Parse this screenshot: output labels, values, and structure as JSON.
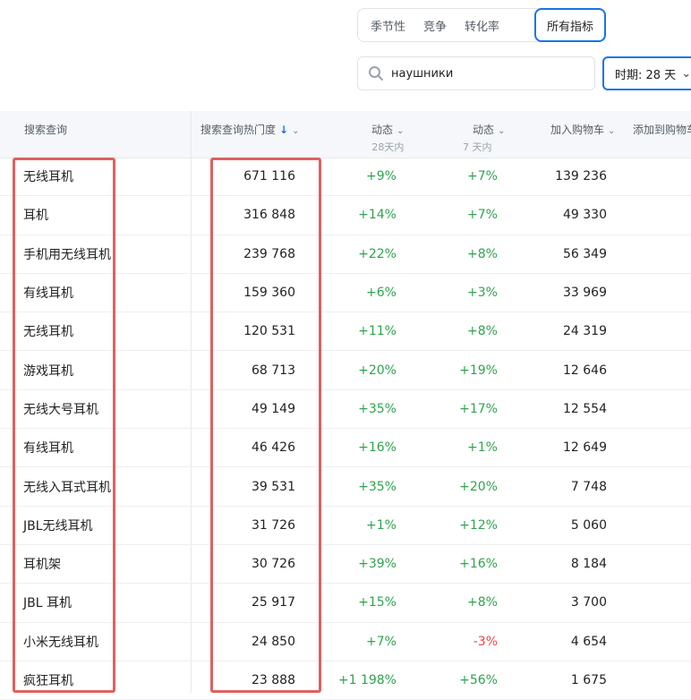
{
  "tabs": [
    {
      "label": "季节性",
      "active": false
    },
    {
      "label": "竞争",
      "active": false
    },
    {
      "label": "转化率",
      "active": false
    },
    {
      "label": "所有指标",
      "active": true
    }
  ],
  "search": {
    "value": "наушники",
    "icon": "search-icon"
  },
  "period": {
    "label": "时期: 28 天",
    "icon": "chevron-down-icon"
  },
  "accent_color": "#1a73e8",
  "positive_color": "#2ea44f",
  "negative_color": "#e5484d",
  "highlight_color": "#e06060",
  "columns": {
    "query": "搜索查询",
    "popularity": "搜索查询热门度",
    "dyn28": "动态",
    "dyn28_sub": "28天内",
    "dyn7": "动态",
    "dyn7_sub": "7 天内",
    "cart": "加入购物车",
    "added": "添加到购物车"
  },
  "rows": [
    {
      "query": "无线耳机",
      "popularity": "671 116",
      "dyn28": "+9%",
      "dyn7": "+7%",
      "cart": "139 236"
    },
    {
      "query": "耳机",
      "popularity": "316 848",
      "dyn28": "+14%",
      "dyn7": "+7%",
      "cart": "49 330"
    },
    {
      "query": "手机用无线耳机",
      "popularity": "239 768",
      "dyn28": "+22%",
      "dyn7": "+8%",
      "cart": "56 349"
    },
    {
      "query": "有线耳机",
      "popularity": "159 360",
      "dyn28": "+6%",
      "dyn7": "+3%",
      "cart": "33 969"
    },
    {
      "query": "无线耳机",
      "popularity": "120 531",
      "dyn28": "+11%",
      "dyn7": "+8%",
      "cart": "24 319"
    },
    {
      "query": "游戏耳机",
      "popularity": "68 713",
      "dyn28": "+20%",
      "dyn7": "+19%",
      "cart": "12 646"
    },
    {
      "query": "无线大号耳机",
      "popularity": "49 149",
      "dyn28": "+35%",
      "dyn7": "+17%",
      "cart": "12 554"
    },
    {
      "query": "有线耳机",
      "popularity": "46 426",
      "dyn28": "+16%",
      "dyn7": "+1%",
      "cart": "12 649"
    },
    {
      "query": "无线入耳式耳机",
      "popularity": "39 531",
      "dyn28": "+35%",
      "dyn7": "+20%",
      "cart": "7 748"
    },
    {
      "query": "JBL无线耳机",
      "popularity": "31 726",
      "dyn28": "+1%",
      "dyn7": "+12%",
      "cart": "5 060"
    },
    {
      "query": "耳机架",
      "popularity": "30 726",
      "dyn28": "+39%",
      "dyn7": "+16%",
      "cart": "8 184"
    },
    {
      "query": "JBL 耳机",
      "popularity": "25 917",
      "dyn28": "+15%",
      "dyn7": "+8%",
      "cart": "3 700"
    },
    {
      "query": "小米无线耳机",
      "popularity": "24 850",
      "dyn28": "+7%",
      "dyn7": "-3%",
      "cart": "4 654"
    },
    {
      "query": "疯狂耳机",
      "popularity": "23 888",
      "dyn28": "+1 198%",
      "dyn7": "+56%",
      "cart": "1 675"
    }
  ]
}
